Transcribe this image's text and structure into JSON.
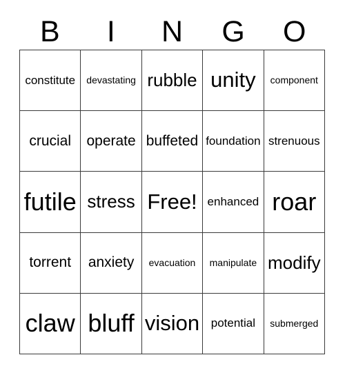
{
  "header": {
    "letters": [
      "B",
      "I",
      "N",
      "G",
      "O"
    ]
  },
  "grid": {
    "rows": [
      [
        {
          "text": "constitute",
          "size": "sm"
        },
        {
          "text": "devastating",
          "size": "xs"
        },
        {
          "text": "rubble",
          "size": "lg"
        },
        {
          "text": "unity",
          "size": "xl"
        },
        {
          "text": "component",
          "size": "xs"
        }
      ],
      [
        {
          "text": "crucial",
          "size": "md"
        },
        {
          "text": "operate",
          "size": "md"
        },
        {
          "text": "buffeted",
          "size": "md"
        },
        {
          "text": "foundation",
          "size": "sm"
        },
        {
          "text": "strenuous",
          "size": "sm"
        }
      ],
      [
        {
          "text": "futile",
          "size": "xxl"
        },
        {
          "text": "stress",
          "size": "lg"
        },
        {
          "text": "Free!",
          "size": "xl"
        },
        {
          "text": "enhanced",
          "size": "sm"
        },
        {
          "text": "roar",
          "size": "xxl"
        }
      ],
      [
        {
          "text": "torrent",
          "size": "md"
        },
        {
          "text": "anxiety",
          "size": "md"
        },
        {
          "text": "evacuation",
          "size": "xs"
        },
        {
          "text": "manipulate",
          "size": "xs"
        },
        {
          "text": "modify",
          "size": "lg"
        }
      ],
      [
        {
          "text": "claw",
          "size": "xxl"
        },
        {
          "text": "bluff",
          "size": "xxl"
        },
        {
          "text": "vision",
          "size": "xl"
        },
        {
          "text": "potential",
          "size": "sm"
        },
        {
          "text": "submerged",
          "size": "xs"
        }
      ]
    ]
  },
  "colors": {
    "border": "#3a3a3a",
    "text": "#000000",
    "background": "#ffffff"
  }
}
